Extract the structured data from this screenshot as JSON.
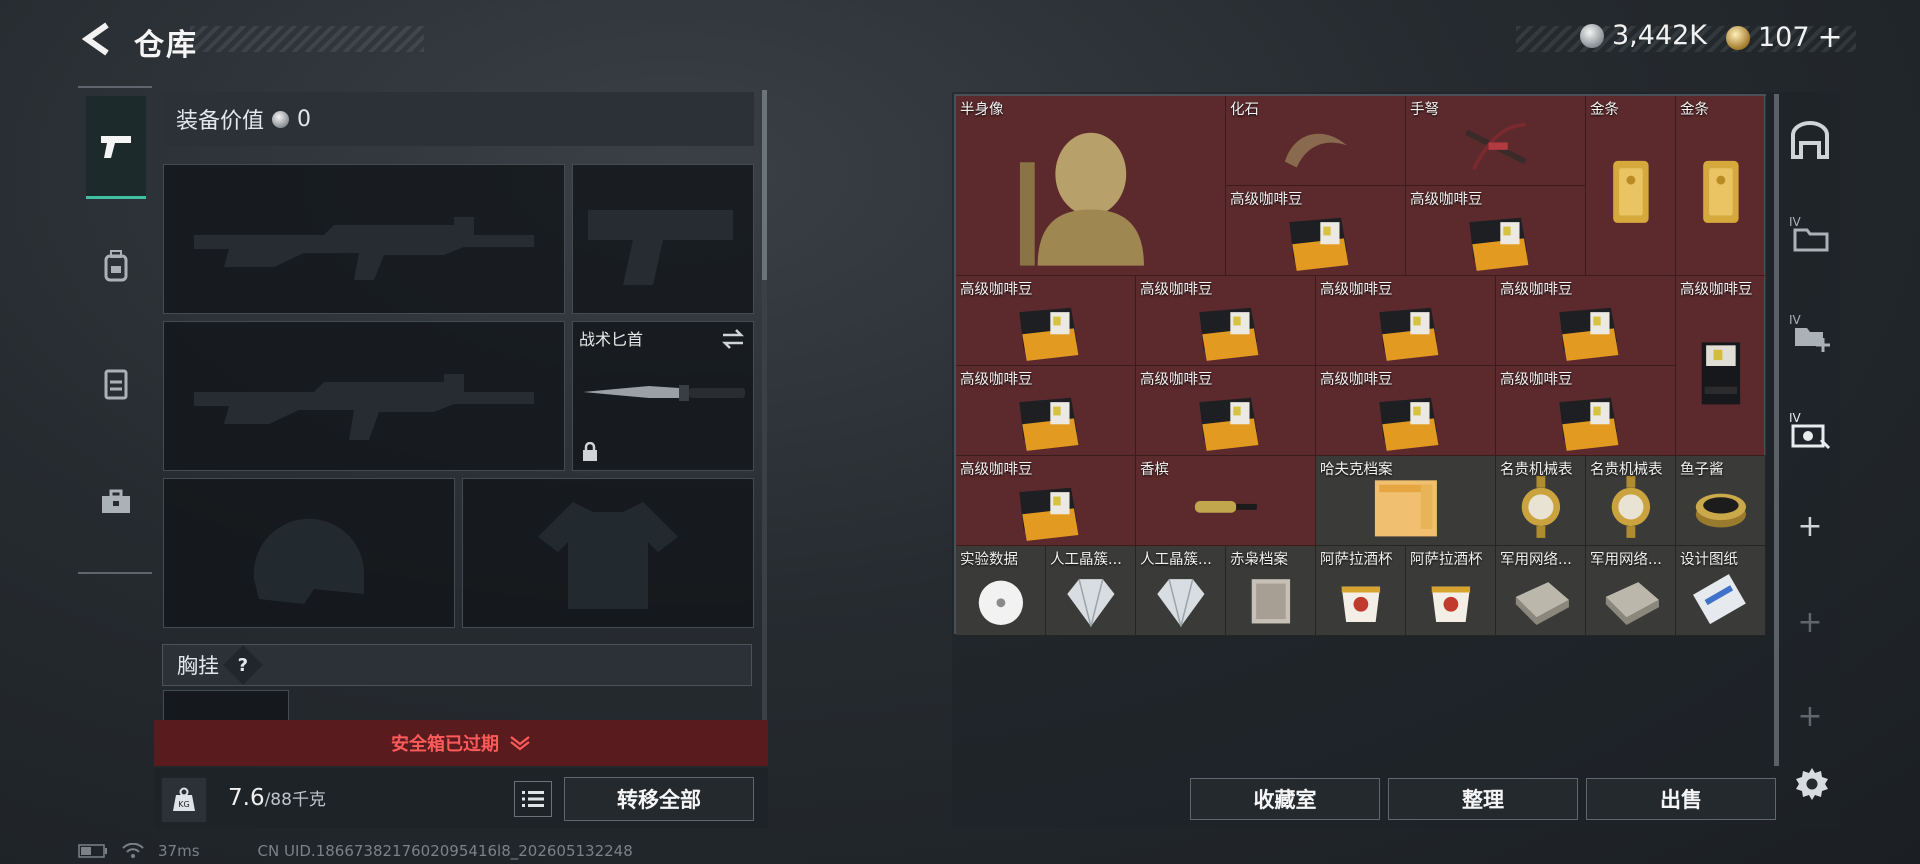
{
  "header": {
    "title": "仓库",
    "back_icon": "chevron-left-icon"
  },
  "currency": {
    "silver": {
      "icon": "silver-coin-icon",
      "value": "3,442K"
    },
    "gold": {
      "icon": "gold-coin-icon",
      "value": "107",
      "add_symbol": "+"
    }
  },
  "left_nav": [
    "pistol-icon",
    "backpack-icon",
    "vest-icon",
    "toolbox-icon"
  ],
  "loadout": {
    "value_label": "装备价值",
    "value": "0",
    "knife_label": "战术匕首",
    "chest_label": "胸挂",
    "help_symbol": "?"
  },
  "safe_box": {
    "expired_text": "安全箱已过期"
  },
  "weight": {
    "current": "7.6",
    "max": "/88千克"
  },
  "buttons": {
    "transfer_all": "转移全部",
    "collection": "收藏室",
    "organize": "整理",
    "sell": "出售"
  },
  "status_bar": {
    "ping": "37ms",
    "uid": "CN UID.1866738217602095416l8_202605132248"
  },
  "stash": {
    "cells": [
      {
        "label": "半身像",
        "art": "bust"
      },
      {
        "label": "化石",
        "art": "fossil"
      },
      {
        "label": "手弩",
        "art": "crossbow"
      },
      {
        "label": "金条",
        "art": "gold-bar"
      },
      {
        "label": "金条",
        "art": "gold-bar"
      },
      {
        "label": "高级咖啡豆",
        "art": "coffee"
      },
      {
        "label": "高级咖啡豆",
        "art": "coffee"
      },
      {
        "label": "高级咖啡豆",
        "art": "coffee"
      },
      {
        "label": "高级咖啡豆",
        "art": "coffee"
      },
      {
        "label": "高级咖啡豆",
        "art": "coffee"
      },
      {
        "label": "高级咖啡豆",
        "art": "coffee"
      },
      {
        "label": "高级咖啡豆",
        "art": "coffee-tall"
      },
      {
        "label": "高级咖啡豆",
        "art": "coffee"
      },
      {
        "label": "高级咖啡豆",
        "art": "coffee"
      },
      {
        "label": "高级咖啡豆",
        "art": "coffee"
      },
      {
        "label": "高级咖啡豆",
        "art": "coffee"
      },
      {
        "label": "高级咖啡豆",
        "art": "coffee"
      },
      {
        "label": "香槟",
        "art": "champagne"
      },
      {
        "label": "哈夫克档案",
        "art": "folder"
      },
      {
        "label": "名贵机械表",
        "art": "watch"
      },
      {
        "label": "名贵机械表",
        "art": "watch"
      },
      {
        "label": "鱼子酱",
        "art": "caviar"
      },
      {
        "label": "实验数据",
        "art": "disc"
      },
      {
        "label": "人工晶簇...",
        "art": "crystal"
      },
      {
        "label": "人工晶簇...",
        "art": "crystal"
      },
      {
        "label": "赤枭档案",
        "art": "archive"
      },
      {
        "label": "阿萨拉酒杯",
        "art": "cup"
      },
      {
        "label": "阿萨拉酒杯",
        "art": "cup"
      },
      {
        "label": "军用网络...",
        "art": "board"
      },
      {
        "label": "军用网络...",
        "art": "board"
      },
      {
        "label": "设计图纸",
        "art": "blueprint"
      }
    ]
  },
  "right_nav": {
    "items": [
      "vault-icon",
      "storage-iv-icon",
      "storage-iv-add-icon",
      "storage-iv-settings-icon",
      "add-icon",
      "add-icon",
      "add-icon"
    ],
    "tab_prefix": "IV"
  }
}
